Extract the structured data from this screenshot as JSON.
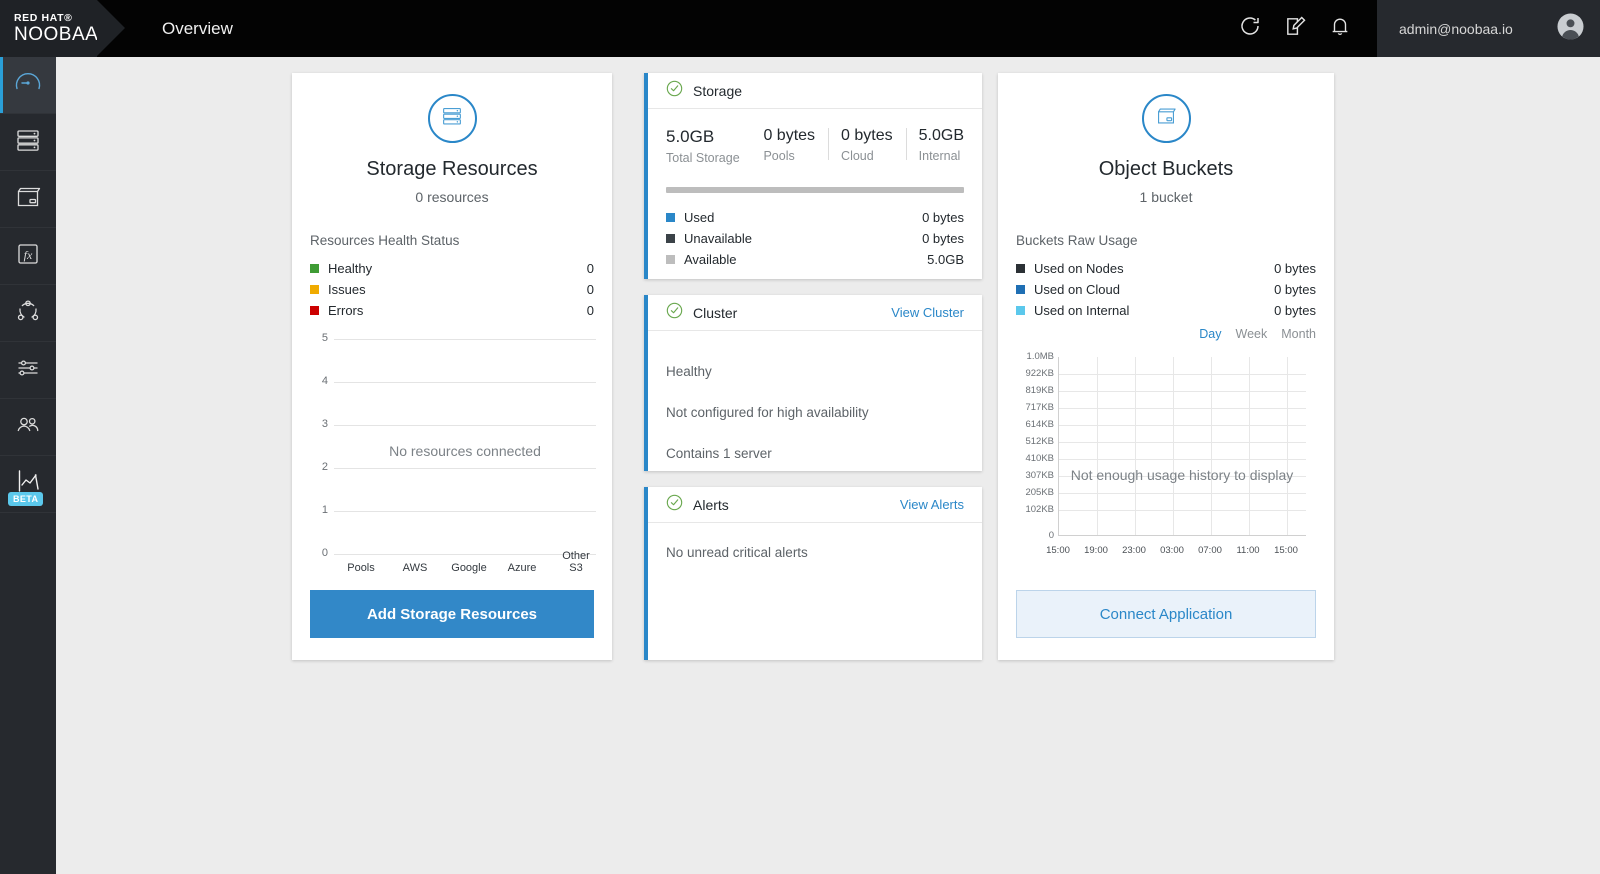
{
  "header": {
    "brand_top": "RED HAT®",
    "brand_bottom": "NOOBAA",
    "page_title": "Overview",
    "icons": [
      "refresh-icon",
      "edit-icon",
      "bell-icon"
    ],
    "user_email": "admin@noobaa.io",
    "avatar": "user-avatar-icon"
  },
  "sidebar": {
    "items": [
      {
        "name": "overview",
        "icon": "gauge-icon",
        "active": true
      },
      {
        "name": "resources",
        "icon": "server-rack-icon",
        "active": false
      },
      {
        "name": "buckets",
        "icon": "bucket-icon",
        "active": false
      },
      {
        "name": "functions",
        "icon": "fx-icon",
        "active": false
      },
      {
        "name": "cluster",
        "icon": "topology-icon",
        "active": false
      },
      {
        "name": "settings",
        "icon": "sliders-icon",
        "active": false
      },
      {
        "name": "accounts",
        "icon": "people-icon",
        "active": false
      },
      {
        "name": "analytics",
        "icon": "line-chart-icon",
        "active": false,
        "badge": "BETA"
      }
    ]
  },
  "storage_resources": {
    "icon": "server-rack-icon",
    "title": "Storage Resources",
    "subtitle": "0 resources",
    "section_label": "Resources Health Status",
    "legend": [
      {
        "label": "Healthy",
        "value": "0",
        "color": "#3f9c35"
      },
      {
        "label": "Issues",
        "value": "0",
        "color": "#f0ab00"
      },
      {
        "label": "Errors",
        "value": "0",
        "color": "#cc0000"
      }
    ],
    "button_label": "Add Storage Resources",
    "button_color": "#3288c8"
  },
  "storage": {
    "status_icon": "check-circle-icon",
    "title": "Storage",
    "total": {
      "value": "5.0GB",
      "label": "Total Storage"
    },
    "breakdown": [
      {
        "value": "0 bytes",
        "label": "Pools"
      },
      {
        "value": "0 bytes",
        "label": "Cloud"
      },
      {
        "value": "5.0GB",
        "label": "Internal"
      }
    ],
    "legend": [
      {
        "label": "Used",
        "value": "0 bytes",
        "color": "#2a87c8"
      },
      {
        "label": "Unavailable",
        "value": "0 bytes",
        "color": "#3b4248"
      },
      {
        "label": "Available",
        "value": "5.0GB",
        "color": "#bdbdbd"
      }
    ]
  },
  "cluster": {
    "status_icon": "check-circle-icon",
    "title": "Cluster",
    "link": "View Cluster",
    "lines": [
      "Healthy",
      "Not configured for high availability",
      "Contains 1 server"
    ]
  },
  "alerts": {
    "status_icon": "check-circle-icon",
    "title": "Alerts",
    "link": "View Alerts",
    "message": "No unread critical alerts"
  },
  "object_buckets": {
    "icon": "bucket-icon",
    "title": "Object Buckets",
    "subtitle": "1 bucket",
    "section_label": "Buckets Raw Usage",
    "legend": [
      {
        "label": "Used on Nodes",
        "value": "0 bytes",
        "color": "#2b3135"
      },
      {
        "label": "Used on Cloud",
        "value": "0 bytes",
        "color": "#1f6fb4"
      },
      {
        "label": "Used on Internal",
        "value": "0 bytes",
        "color": "#5bc8ec"
      }
    ],
    "range_tabs": [
      {
        "label": "Day",
        "active": true
      },
      {
        "label": "Week",
        "active": false
      },
      {
        "label": "Month",
        "active": false
      }
    ],
    "button_label": "Connect Application"
  },
  "chart_data": [
    {
      "type": "bar",
      "title": "Resources Health Status",
      "categories": [
        "Pools",
        "AWS",
        "Google",
        "Azure",
        "Other S3"
      ],
      "series": [
        {
          "name": "Healthy",
          "values": [
            0,
            0,
            0,
            0,
            0
          ],
          "color": "#3f9c35"
        },
        {
          "name": "Issues",
          "values": [
            0,
            0,
            0,
            0,
            0
          ],
          "color": "#f0ab00"
        },
        {
          "name": "Errors",
          "values": [
            0,
            0,
            0,
            0,
            0
          ],
          "color": "#cc0000"
        }
      ],
      "yticks": [
        "5",
        "4",
        "3",
        "2",
        "1",
        "0"
      ],
      "ylim": [
        0,
        5
      ],
      "xlabel": "",
      "ylabel": "",
      "grid": true,
      "empty_message": "No resources connected"
    },
    {
      "type": "line",
      "title": "Buckets Raw Usage",
      "x": [
        "15:00",
        "19:00",
        "23:00",
        "03:00",
        "07:00",
        "11:00",
        "15:00"
      ],
      "series": [
        {
          "name": "Used on Nodes",
          "values": [],
          "color": "#2b3135"
        },
        {
          "name": "Used on Cloud",
          "values": [],
          "color": "#1f6fb4"
        },
        {
          "name": "Used on Internal",
          "values": [],
          "color": "#5bc8ec"
        }
      ],
      "yticks": [
        "1.0MB",
        "922KB",
        "819KB",
        "717KB",
        "614KB",
        "512KB",
        "410KB",
        "307KB",
        "205KB",
        "102KB",
        "0"
      ],
      "ylim": [
        0,
        1048576
      ],
      "xlabel": "",
      "ylabel": "",
      "grid": true,
      "empty_message": "Not enough usage history to display"
    }
  ]
}
